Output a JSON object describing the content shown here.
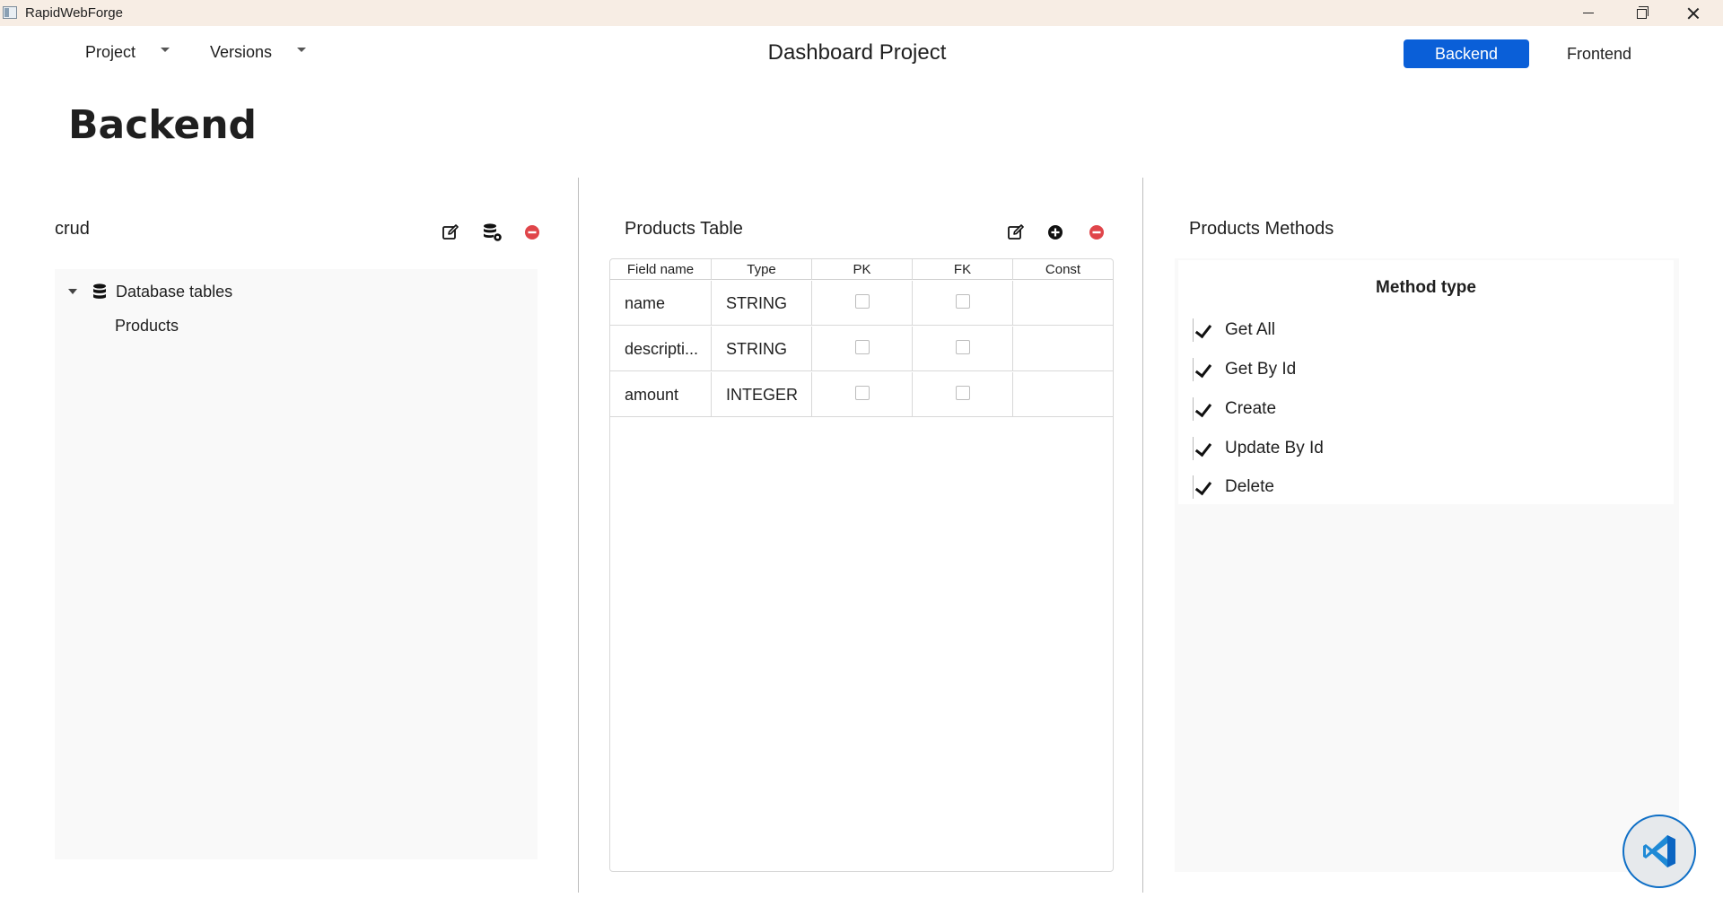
{
  "window": {
    "title": "RapidWebForge"
  },
  "topbar": {
    "menus": [
      "Project",
      "Versions"
    ],
    "project_title": "Dashboard Project",
    "nav": {
      "backend_label": "Backend",
      "frontend_label": "Frontend",
      "active": "Backend"
    },
    "accent_color": "#0a5fd8"
  },
  "page": {
    "heading": "Backend"
  },
  "left_panel": {
    "title": "crud",
    "toolbar_icons": [
      "edit-icon",
      "database-settings-icon",
      "remove-icon"
    ],
    "tree": {
      "root_label": "Database tables",
      "root_expanded": true,
      "children": [
        "Products"
      ]
    }
  },
  "middle_panel": {
    "title": "Products Table",
    "toolbar_icons": [
      "edit-icon",
      "add-icon",
      "remove-icon"
    ],
    "columns": [
      "Field name",
      "Type",
      "PK",
      "FK",
      "Const"
    ],
    "rows": [
      {
        "field": "name",
        "type": "STRING",
        "pk": false,
        "fk": false,
        "const": ""
      },
      {
        "field": "descripti...",
        "type": "STRING",
        "pk": false,
        "fk": false,
        "const": ""
      },
      {
        "field": "amount",
        "type": "INTEGER",
        "pk": false,
        "fk": false,
        "const": ""
      }
    ]
  },
  "right_panel": {
    "title": "Products Methods",
    "header": "Method type",
    "methods": [
      {
        "label": "Get All",
        "checked": true
      },
      {
        "label": "Get By Id",
        "checked": true
      },
      {
        "label": "Create",
        "checked": true
      },
      {
        "label": "Update By Id",
        "checked": true
      },
      {
        "label": "Delete",
        "checked": true
      }
    ]
  },
  "floating_button": {
    "icon": "vscode-icon"
  }
}
